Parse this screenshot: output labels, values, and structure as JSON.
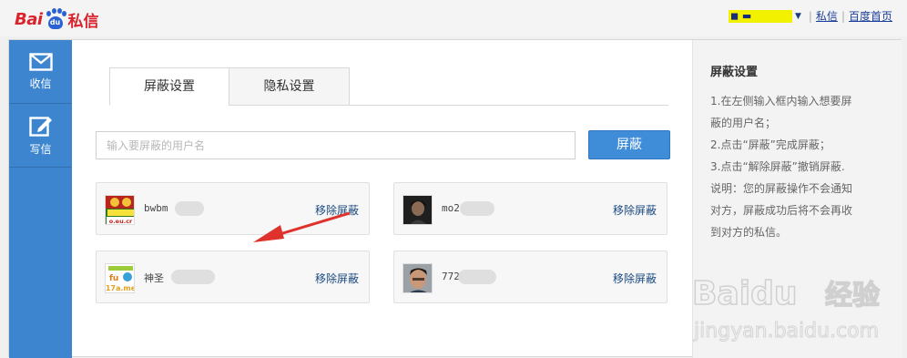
{
  "header": {
    "logo_left": "Bai",
    "logo_paw": "du",
    "logo_right": "私信",
    "username": "◼ ▬ ■▬▬◼",
    "links": [
      "私信",
      "百度首页"
    ]
  },
  "leftnav": [
    {
      "label": "收信",
      "icon": "envelope-icon"
    },
    {
      "label": "写信",
      "icon": "compose-icon"
    }
  ],
  "tabs": [
    "屏蔽设置",
    "隐私设置"
  ],
  "search": {
    "placeholder": "输入要屏蔽的用户名",
    "button": "屏蔽"
  },
  "blocked": [
    {
      "name": "bwbm",
      "action": "移除屏蔽"
    },
    {
      "name": "mo2",
      "action": "移除屏蔽"
    },
    {
      "name": "神圣",
      "action": "移除屏蔽"
    },
    {
      "name": "772",
      "action": "移除屏蔽"
    }
  ],
  "help": {
    "title": "屏蔽设置",
    "lines": [
      "1.在左侧输入框内输入想要屏",
      "蔽的用户名；",
      "2.点击“屏蔽”完成屏蔽；",
      "3.点击“解除屏蔽”撤销屏蔽.",
      "说明：您的屏蔽操作不会通知",
      "对方，屏蔽成功后将不会再收",
      "到对方的私信。"
    ]
  },
  "watermark": {
    "brand": "Baidu",
    "brand_cn": "经验",
    "url": "jingyan.baidu.com"
  },
  "colors": {
    "nav_blue": "#3d86cf",
    "button_blue": "#3f8dd8",
    "logo_red": "#d9232d",
    "arrow_red": "#e0322c"
  }
}
